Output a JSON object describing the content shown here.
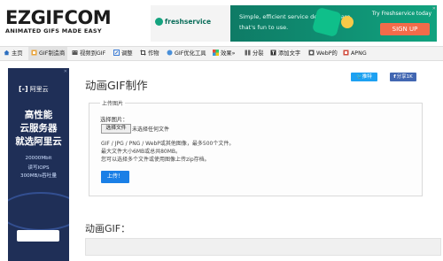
{
  "logo": {
    "main": "EZGIFCOM",
    "tagline": "ANIMATED GIFS MADE EASY"
  },
  "top_ad": {
    "brand": "freshservice",
    "message_line1": "Simple, efficient service desk software",
    "message_line2": "that's fun to use.",
    "try_text": "Try Freshservice today",
    "cta": "SIGN UP"
  },
  "nav": [
    {
      "label": "主页",
      "icon": "home-icon"
    },
    {
      "label": "GIF制造商",
      "icon": "gif-maker-icon"
    },
    {
      "label": "视频到GIF",
      "icon": "video-to-gif-icon"
    },
    {
      "label": "调整",
      "icon": "resize-icon"
    },
    {
      "label": "作物",
      "icon": "crop-icon"
    },
    {
      "label": "GIF优化工具",
      "icon": "optimize-icon"
    },
    {
      "label": "效果»",
      "icon": "effects-icon"
    },
    {
      "label": "分裂",
      "icon": "split-icon"
    },
    {
      "label": "添加文字",
      "icon": "add-text-icon"
    },
    {
      "label": "WebP的",
      "icon": "webp-icon"
    },
    {
      "label": "APNG",
      "icon": "apng-icon"
    }
  ],
  "side_ad": {
    "brand": "阿里云",
    "headline1": "高性能",
    "headline2": "云服务器",
    "headline3": "就选阿里云",
    "detail1": "20000Mbit",
    "detail2": "读写IOPS",
    "detail3": "300MB/s吞吐量"
  },
  "page": {
    "title": "动画GIF制作",
    "share_twitter": "推特",
    "share_facebook": "分享1K"
  },
  "upload": {
    "legend": "上传图片",
    "choose_label": "选择图片：",
    "file_button": "选择文件",
    "no_file": "未选择任何文件",
    "info_line1": "GIF / JPG / PNG / WebP或其他图像，最多500个文件。",
    "info_line2": "最大文件大小6MB或总共80MB。",
    "info_line3": "您可以选择多个文件或使用图像上传zip存档。",
    "submit": "上传！"
  },
  "result": {
    "title": "动画GIF："
  },
  "colors": {
    "accent_blue": "#1a7fe6",
    "nav_bg": "#f3f3f3",
    "twitter": "#1da1f2",
    "facebook": "#4267b2",
    "ad_green": "#0f8a6f",
    "side_ad_bg": "#1f2f57"
  }
}
